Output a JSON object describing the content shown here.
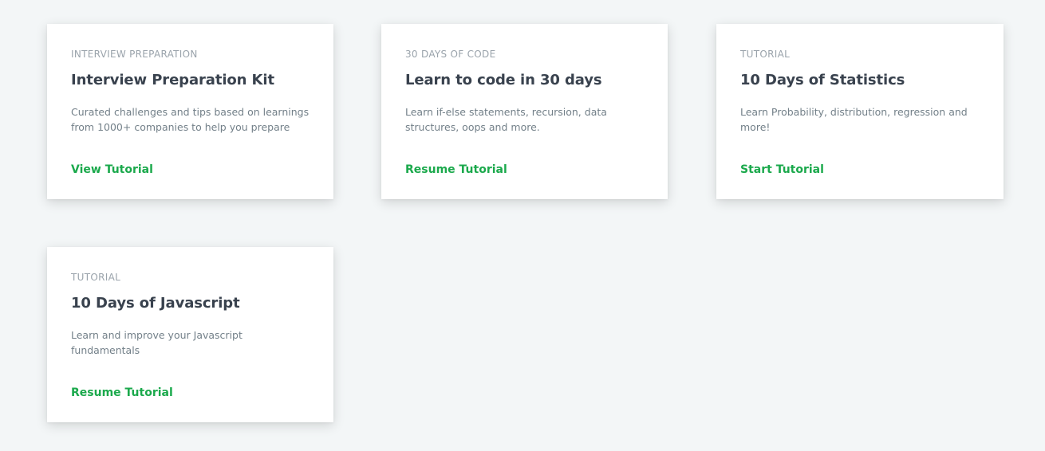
{
  "cards": [
    {
      "category": "INTERVIEW PREPARATION",
      "title": "Interview Preparation Kit",
      "description": "Curated challenges and tips based on learnings from 1000+ companies to help you prepare",
      "action": "View Tutorial"
    },
    {
      "category": "30 DAYS OF CODE",
      "title": "Learn to code in 30 days",
      "description": "Learn if-else statements, recursion, data structures, oops and more.",
      "action": "Resume Tutorial"
    },
    {
      "category": "TUTORIAL",
      "title": "10 Days of Statistics",
      "description": "Learn Probability, distribution, regression and more!",
      "action": "Start Tutorial"
    },
    {
      "category": "TUTORIAL",
      "title": "10 Days of Javascript",
      "description": "Learn and improve your Javascript fundamentals",
      "action": "Resume Tutorial"
    }
  ],
  "colors": {
    "background": "#f3f6f7",
    "card": "#ffffff",
    "title": "#39424e",
    "description": "#738089",
    "category": "#9aa3ab",
    "accent": "#1ba94c"
  }
}
